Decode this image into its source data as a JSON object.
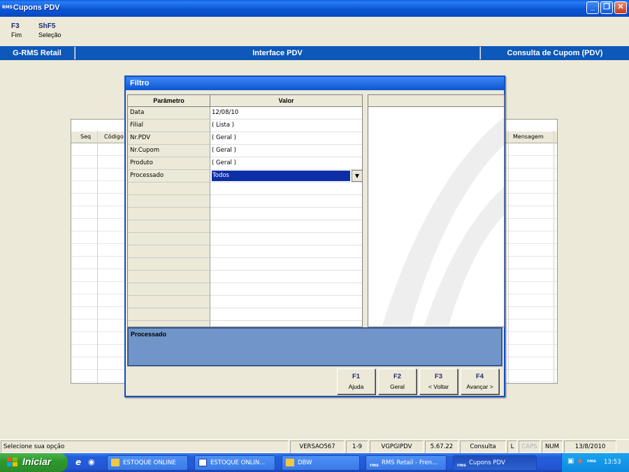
{
  "window": {
    "logo": "RMS",
    "title": "Cupons PDV",
    "controls": [
      "minimize",
      "maximize",
      "close"
    ]
  },
  "hotkeys": [
    {
      "key": "F3",
      "label": "Fim"
    },
    {
      "key": "ShF5",
      "label": "Seleção"
    }
  ],
  "header": {
    "left": "G-RMS Retail",
    "center": "Interface PDV",
    "right": "Consulta de Cupom (PDV)"
  },
  "background_grid": {
    "columns": [
      "Seq",
      "Código",
      "Mensagem"
    ]
  },
  "dialog": {
    "title": "Filtro",
    "columns": {
      "param": "Parâmetro",
      "value": "Valor"
    },
    "rows": [
      {
        "param": "Data",
        "value": "12/08/10"
      },
      {
        "param": "Filial",
        "value": "( Lista )"
      },
      {
        "param": "Nr.PDV",
        "value": "( Geral )"
      },
      {
        "param": "Nr.Cupom",
        "value": "( Geral )"
      },
      {
        "param": "Produto",
        "value": "( Geral )"
      },
      {
        "param": "Processado",
        "value": "Todos"
      }
    ],
    "help_text": "Processado",
    "buttons": [
      {
        "key": "F1",
        "label": "Ajuda"
      },
      {
        "key": "F2",
        "label": "Geral"
      },
      {
        "key": "F3",
        "label": "< Voltar"
      },
      {
        "key": "F4",
        "label": "Avançar >"
      }
    ]
  },
  "status_bar": {
    "message": "Selecione sua opção",
    "version": "VERSAO567",
    "range": "1-9",
    "program": "VGPGIPDV",
    "build": "5.67.22",
    "mode": "Consulta",
    "l": "L",
    "caps": "CAPS",
    "num": "NUM",
    "date": "13/8/2010"
  },
  "taskbar": {
    "start_label": "Iniciar",
    "items": [
      {
        "label": "ESTOQUE ONLINE",
        "icon": "folder-icon"
      },
      {
        "label": "ESTOQUE ONLIN...",
        "icon": "word-doc-icon"
      },
      {
        "label": "DBW",
        "icon": "folder-icon"
      },
      {
        "label": "RMS Retail - Fren...",
        "icon": "rms-app-icon"
      },
      {
        "label": "Cupons PDV",
        "icon": "rms-app-icon"
      }
    ],
    "clock": "13:53"
  },
  "colors": {
    "header_blue": "#0d58b8",
    "selection_blue": "#0c2fa8",
    "help_panel": "#7095c8"
  }
}
